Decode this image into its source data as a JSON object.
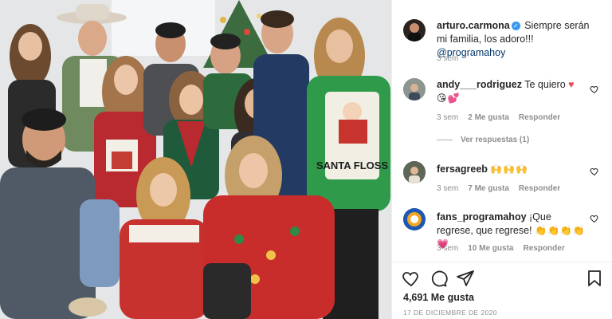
{
  "post": {
    "author": "arturo.carmona",
    "caption": "Siempre serán mi familia, los adoro!!!",
    "mention": "@programahoy",
    "time": "3 sem"
  },
  "comments": [
    {
      "username": "andy___rodriguez",
      "text": "Te quiero",
      "emojis": "😘💕",
      "time": "3 sem",
      "likes": "2 Me gusta",
      "reply": "Responder",
      "view_replies": "Ver respuestas (1)"
    },
    {
      "username": "fersagreeb",
      "text": "",
      "emojis": "🙌🙌🙌",
      "time": "3 sem",
      "likes": "7 Me gusta",
      "reply": "Responder"
    },
    {
      "username": "fans_programahoy",
      "text": "¡Que regrese, que regrese!",
      "emojis": "👏👏👏👏💗",
      "time": "3 sem",
      "likes": "10 Me gusta",
      "reply": "Responder"
    }
  ],
  "actions": {
    "likes_count": "4,691 Me gusta",
    "date": "17 DE DICIEMBRE DE 2020"
  },
  "photo": {
    "sweater_text": "SANTA FLOSS"
  },
  "colors": {
    "verified": "#3897f0",
    "heart_red": "#ed4956",
    "mention": "#00376b",
    "muted": "#8e8e8e"
  }
}
